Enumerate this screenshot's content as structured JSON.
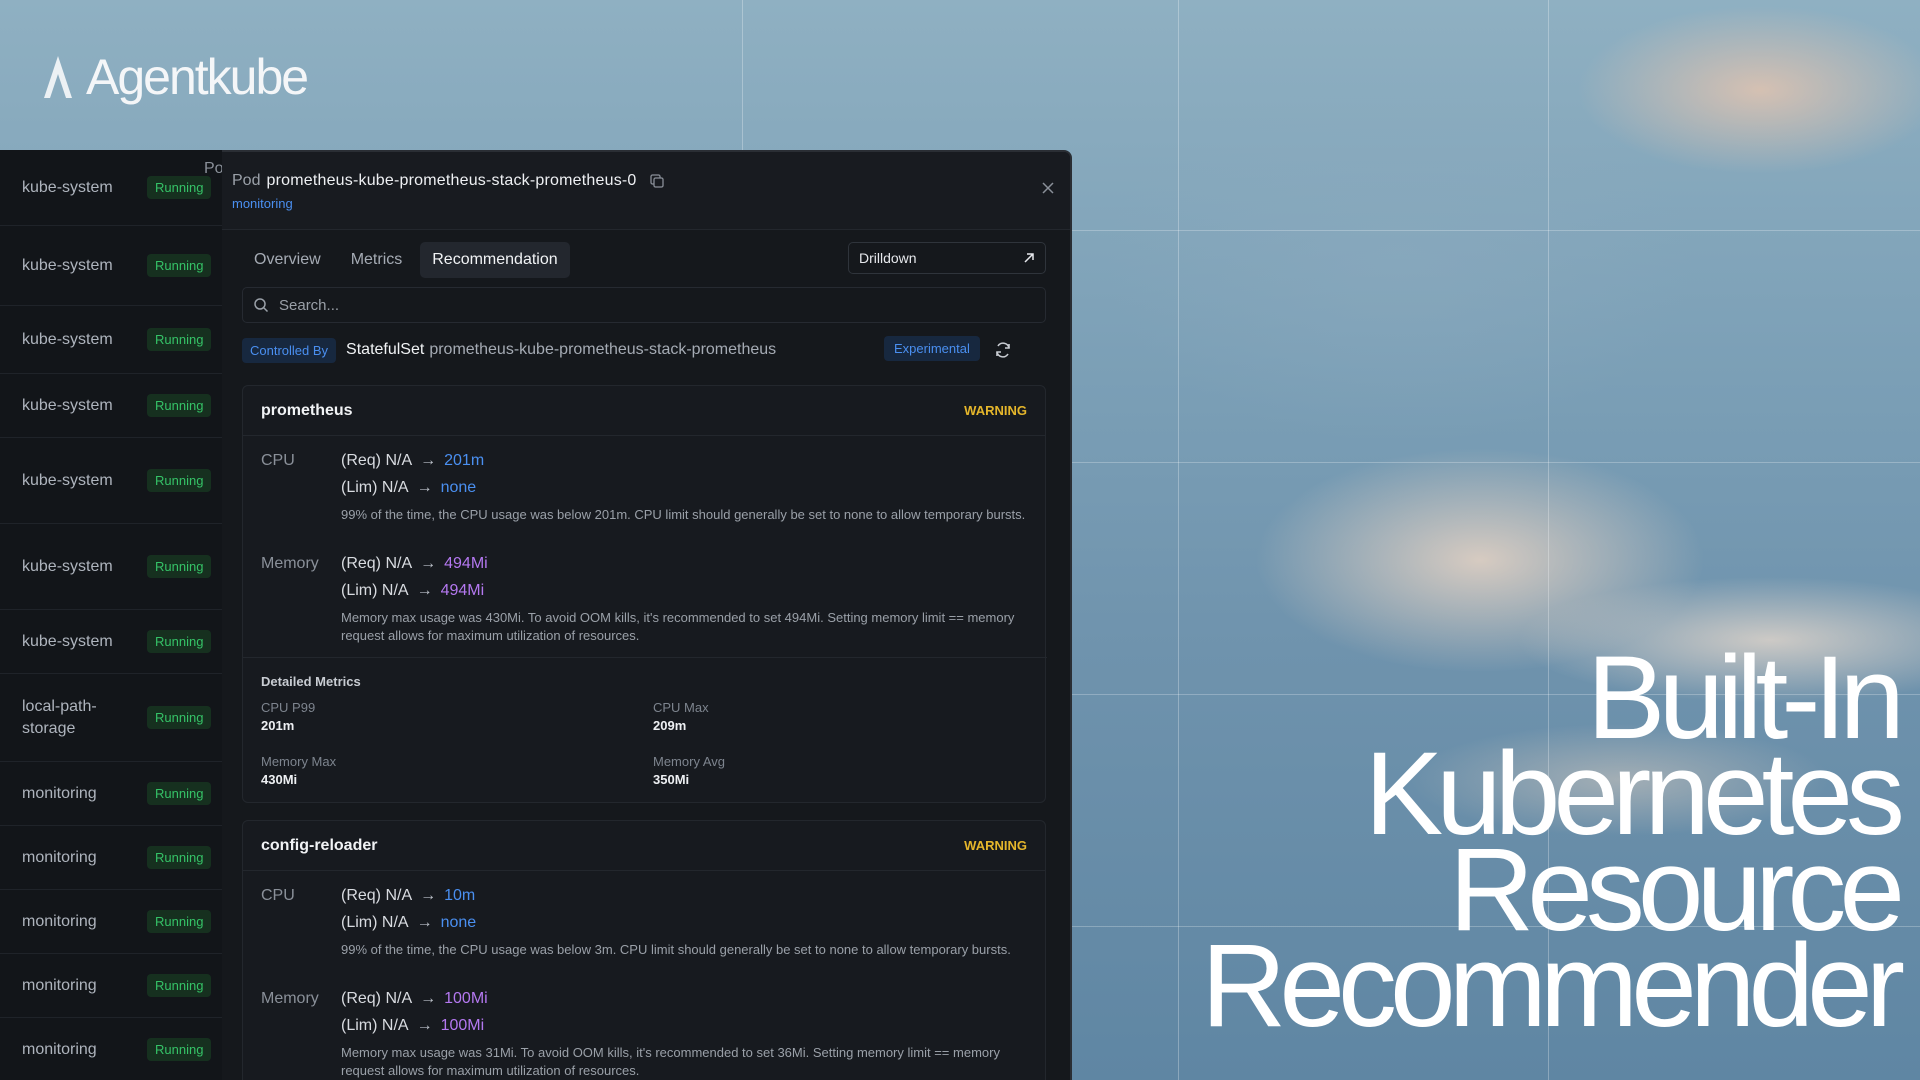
{
  "brand": {
    "name": "Agentkube"
  },
  "headline": [
    "Built-In",
    "Kubernetes",
    "Resource",
    "Recommender"
  ],
  "pod_list": {
    "header": "Po",
    "rows": [
      {
        "namespace": "kube-system",
        "status": "Running"
      },
      {
        "namespace": "kube-system",
        "status": "Running"
      },
      {
        "namespace": "kube-system",
        "status": "Running"
      },
      {
        "namespace": "kube-system",
        "status": "Running"
      },
      {
        "namespace": "kube-system",
        "status": "Running"
      },
      {
        "namespace": "kube-system",
        "status": "Running"
      },
      {
        "namespace": "kube-system",
        "status": "Running"
      },
      {
        "namespace": "local-path-storage",
        "status": "Running"
      },
      {
        "namespace": "monitoring",
        "status": "Running"
      },
      {
        "namespace": "monitoring",
        "status": "Running"
      },
      {
        "namespace": "monitoring",
        "status": "Running"
      },
      {
        "namespace": "monitoring",
        "status": "Running"
      },
      {
        "namespace": "monitoring",
        "status": "Running"
      }
    ]
  },
  "panel": {
    "kind": "Pod",
    "name": "prometheus-kube-prometheus-stack-prometheus-0",
    "namespace": "monitoring",
    "tabs": [
      "Overview",
      "Metrics",
      "Recommendation"
    ],
    "active_tab": "Recommendation",
    "drilldown_label": "Drilldown",
    "search_placeholder": "Search...",
    "controlled_by_label": "Controlled By",
    "controller_kind": "StatefulSet",
    "controller_name": "prometheus-kube-prometheus-stack-prometheus",
    "experimental_label": "Experimental",
    "containers": [
      {
        "name": "prometheus",
        "severity": "WARNING",
        "cpu": {
          "label": "CPU",
          "req_prefix": "(Req) N/A",
          "req_value": "201m",
          "lim_prefix": "(Lim) N/A",
          "lim_value": "none",
          "note": "99% of the time, the CPU usage was below 201m. CPU limit should generally be set to none to allow temporary bursts."
        },
        "memory": {
          "label": "Memory",
          "req_prefix": "(Req) N/A",
          "req_value": "494Mi",
          "lim_prefix": "(Lim) N/A",
          "lim_value": "494Mi",
          "note": "Memory max usage was 430Mi. To avoid OOM kills, it's recommended to set 494Mi. Setting memory limit == memory request allows for maximum utilization of resources."
        },
        "detailed_metrics": {
          "title": "Detailed Metrics",
          "items": [
            {
              "label": "CPU P99",
              "value": "201m"
            },
            {
              "label": "CPU Max",
              "value": "209m"
            },
            {
              "label": "Memory Max",
              "value": "430Mi"
            },
            {
              "label": "Memory Avg",
              "value": "350Mi"
            }
          ]
        }
      },
      {
        "name": "config-reloader",
        "severity": "WARNING",
        "cpu": {
          "label": "CPU",
          "req_prefix": "(Req) N/A",
          "req_value": "10m",
          "lim_prefix": "(Lim) N/A",
          "lim_value": "none",
          "note": "99% of the time, the CPU usage was below 3m. CPU limit should generally be set to none to allow temporary bursts."
        },
        "memory": {
          "label": "Memory",
          "req_prefix": "(Req) N/A",
          "req_value": "100Mi",
          "lim_prefix": "(Lim) N/A",
          "lim_value": "100Mi",
          "note": "Memory max usage was 31Mi. To avoid OOM kills, it's recommended to set 36Mi. Setting memory limit == memory request allows for maximum utilization of resources."
        }
      }
    ]
  },
  "colors": {
    "accent_blue": "#4a8ff0",
    "memory_purple": "#b478f0",
    "warning": "#e5b62b",
    "running_green": "#35c267"
  }
}
